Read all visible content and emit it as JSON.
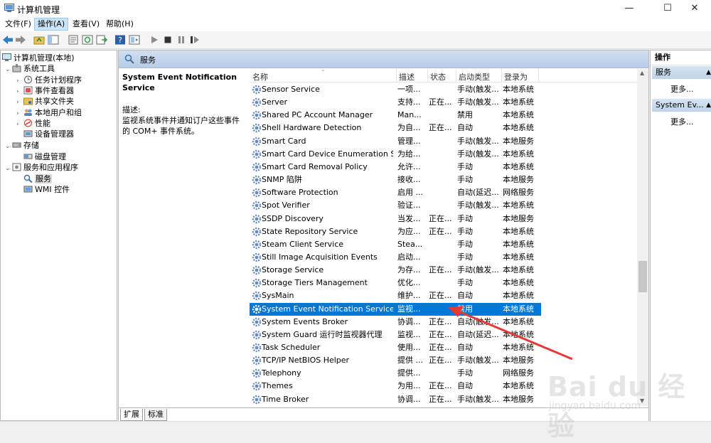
{
  "window": {
    "title": "计算机管理",
    "minimize": "—",
    "maximize": "☐",
    "close": "✕"
  },
  "menubar": [
    {
      "label": "文件(F)",
      "active": false
    },
    {
      "label": "操作(A)",
      "active": true
    },
    {
      "label": "查看(V)",
      "active": false
    },
    {
      "label": "帮助(H)",
      "active": false
    }
  ],
  "toolbar": [
    "back-icon",
    "forward-icon",
    "up-folder-icon",
    "show-tree-icon",
    "properties-icon",
    "refresh-icon",
    "export-icon",
    "help-icon",
    "view-icon",
    "play-icon",
    "stop-icon",
    "pause-icon",
    "restart-icon"
  ],
  "tree": [
    {
      "label": "计算机管理(本地)",
      "level": 0,
      "expander": "",
      "icon": "computer-icon",
      "selected": false
    },
    {
      "label": "系统工具",
      "level": 1,
      "expander": "⌄",
      "icon": "tools-icon",
      "selected": false
    },
    {
      "label": "任务计划程序",
      "level": 2,
      "expander": "›",
      "icon": "clock-icon",
      "selected": false
    },
    {
      "label": "事件查看器",
      "level": 2,
      "expander": "›",
      "icon": "event-viewer-icon",
      "selected": false
    },
    {
      "label": "共享文件夹",
      "level": 2,
      "expander": "›",
      "icon": "shared-folder-icon",
      "selected": false
    },
    {
      "label": "本地用户和组",
      "level": 2,
      "expander": "›",
      "icon": "users-icon",
      "selected": false
    },
    {
      "label": "性能",
      "level": 2,
      "expander": "›",
      "icon": "performance-icon",
      "selected": false
    },
    {
      "label": "设备管理器",
      "level": 2,
      "expander": "",
      "icon": "device-manager-icon",
      "selected": false
    },
    {
      "label": "存储",
      "level": 1,
      "expander": "⌄",
      "icon": "storage-icon",
      "selected": false
    },
    {
      "label": "磁盘管理",
      "level": 2,
      "expander": "",
      "icon": "disk-icon",
      "selected": false
    },
    {
      "label": "服务和应用程序",
      "level": 1,
      "expander": "⌄",
      "icon": "services-apps-icon",
      "selected": false
    },
    {
      "label": "服务",
      "level": 2,
      "expander": "",
      "icon": "services-icon",
      "selected": true
    },
    {
      "label": "WMI 控件",
      "level": 2,
      "expander": "",
      "icon": "wmi-icon",
      "selected": false
    }
  ],
  "panel": {
    "header": "服务",
    "description_title": "System Event Notification Service",
    "description_label": "描述:",
    "description_text": "监视系统事件并通知订户这些事件的 COM+ 事件系统。"
  },
  "columns": [
    "名称",
    "描述",
    "状态",
    "启动类型",
    "登录为"
  ],
  "services": [
    {
      "name": "Sensor Service",
      "desc": "一项...",
      "status": "",
      "startup": "手动(触发...",
      "logon": "本地系统"
    },
    {
      "name": "Server",
      "desc": "支持...",
      "status": "正在...",
      "startup": "手动(触发...",
      "logon": "本地系统"
    },
    {
      "name": "Shared PC Account Manager",
      "desc": "Man...",
      "status": "",
      "startup": "禁用",
      "logon": "本地系统"
    },
    {
      "name": "Shell Hardware Detection",
      "desc": "为自...",
      "status": "正在...",
      "startup": "自动",
      "logon": "本地系统"
    },
    {
      "name": "Smart Card",
      "desc": "管理...",
      "status": "",
      "startup": "手动(触发...",
      "logon": "本地服务"
    },
    {
      "name": "Smart Card Device Enumeration Servi...",
      "desc": "为给...",
      "status": "",
      "startup": "手动(触发...",
      "logon": "本地系统"
    },
    {
      "name": "Smart Card Removal Policy",
      "desc": "允许...",
      "status": "",
      "startup": "手动",
      "logon": "本地系统"
    },
    {
      "name": "SNMP 陷阱",
      "desc": "接收...",
      "status": "",
      "startup": "手动",
      "logon": "本地服务"
    },
    {
      "name": "Software Protection",
      "desc": "启用 ...",
      "status": "",
      "startup": "自动(延迟...",
      "logon": "网络服务"
    },
    {
      "name": "Spot Verifier",
      "desc": "验证...",
      "status": "",
      "startup": "手动(触发...",
      "logon": "本地系统"
    },
    {
      "name": "SSDP Discovery",
      "desc": "当发...",
      "status": "正在...",
      "startup": "手动",
      "logon": "本地服务"
    },
    {
      "name": "State Repository Service",
      "desc": "为应...",
      "status": "正在...",
      "startup": "手动",
      "logon": "本地系统"
    },
    {
      "name": "Steam Client Service",
      "desc": "Stea...",
      "status": "",
      "startup": "手动",
      "logon": "本地系统"
    },
    {
      "name": "Still Image Acquisition Events",
      "desc": "启动...",
      "status": "",
      "startup": "手动",
      "logon": "本地系统"
    },
    {
      "name": "Storage Service",
      "desc": "为存...",
      "status": "正在...",
      "startup": "手动(触发...",
      "logon": "本地系统"
    },
    {
      "name": "Storage Tiers Management",
      "desc": "优化...",
      "status": "",
      "startup": "手动",
      "logon": "本地系统"
    },
    {
      "name": "SysMain",
      "desc": "维护...",
      "status": "正在...",
      "startup": "自动",
      "logon": "本地系统"
    },
    {
      "name": "System Event Notification Service",
      "desc": "监视...",
      "status": "",
      "startup": "禁用",
      "logon": "本地系统",
      "selected": true
    },
    {
      "name": "System Events Broker",
      "desc": "协调...",
      "status": "正在...",
      "startup": "自动(触发...",
      "logon": "本地系统"
    },
    {
      "name": "System Guard 运行时监视器代理",
      "desc": "监视...",
      "status": "正在...",
      "startup": "自动(延迟...",
      "logon": "本地系统"
    },
    {
      "name": "Task Scheduler",
      "desc": "使用...",
      "status": "正在...",
      "startup": "自动",
      "logon": "本地系统"
    },
    {
      "name": "TCP/IP NetBIOS Helper",
      "desc": "提供 ...",
      "status": "正在...",
      "startup": "手动(触发...",
      "logon": "本地服务"
    },
    {
      "name": "Telephony",
      "desc": "提供...",
      "status": "",
      "startup": "手动",
      "logon": "网络服务"
    },
    {
      "name": "Themes",
      "desc": "为用...",
      "status": "正在...",
      "startup": "自动",
      "logon": "本地系统"
    },
    {
      "name": "Time Broker",
      "desc": "协调...",
      "status": "正在...",
      "startup": "手动(触发...",
      "logon": "本地服务"
    }
  ],
  "bottom_tabs": [
    "扩展",
    "标准"
  ],
  "actions": {
    "title": "操作",
    "sections": [
      {
        "label": "服务",
        "more": "更多..."
      },
      {
        "label": "System Ev...",
        "more": "更多..."
      }
    ]
  },
  "watermark": {
    "brand": "Bai du 经验",
    "url": "jingyan.baidu.com"
  },
  "colors": {
    "selection": "#0078d7",
    "header": "#c4d7ec",
    "arrow": "#e53935"
  }
}
